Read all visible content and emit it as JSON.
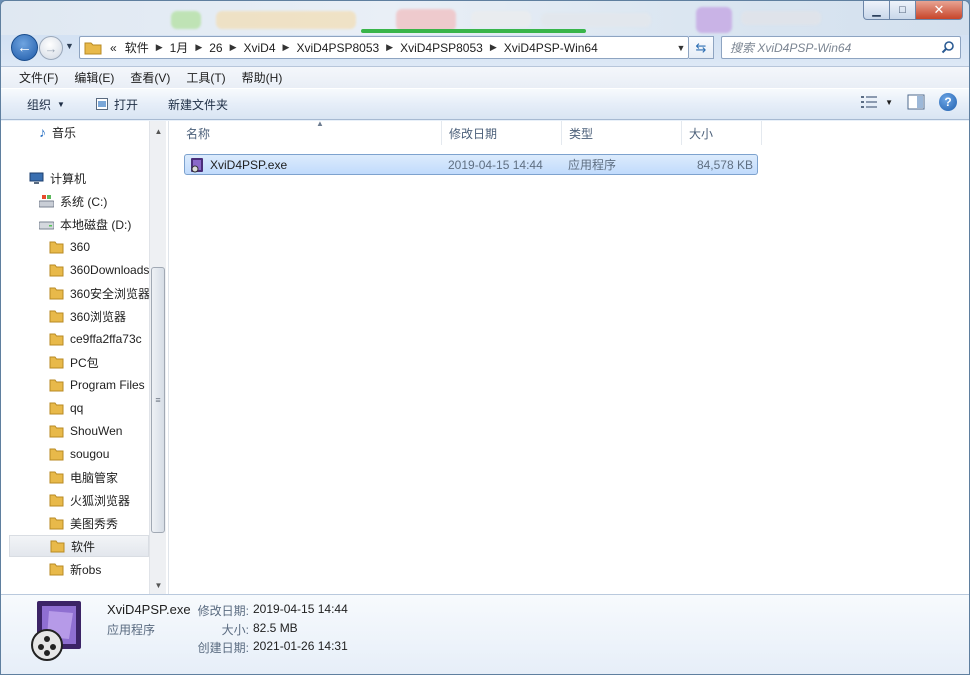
{
  "window": {
    "caption": {
      "minimize": "▁",
      "maximize": "□",
      "close": "✕"
    }
  },
  "nav": {
    "back_icon": "arrow-left-icon",
    "forward_icon": "arrow-right-icon",
    "breadcrumbs": [
      "«",
      "软件",
      "1月",
      "26",
      "XviD4",
      "XviD4PSP8053",
      "XviD4PSP8053",
      "XviD4PSP-Win64"
    ],
    "search_placeholder": "搜索 XviD4PSP-Win64"
  },
  "menu": [
    "文件(F)",
    "编辑(E)",
    "查看(V)",
    "工具(T)",
    "帮助(H)"
  ],
  "commands": {
    "organize": "组织",
    "open": "打开",
    "new_folder": "新建文件夹"
  },
  "sidebar": {
    "items": [
      {
        "label": "音乐",
        "icon": "music-icon"
      },
      {
        "label": "计算机",
        "icon": "computer-icon"
      },
      {
        "label": "系统 (C:)",
        "icon": "drive-c-icon"
      },
      {
        "label": "本地磁盘 (D:)",
        "icon": "drive-icon"
      },
      {
        "label": "360",
        "icon": "folder-icon"
      },
      {
        "label": "360Downloads",
        "icon": "folder-icon"
      },
      {
        "label": "360安全浏览器",
        "icon": "folder-icon"
      },
      {
        "label": "360浏览器",
        "icon": "folder-icon"
      },
      {
        "label": "ce9ffa2ffa73c",
        "icon": "folder-icon"
      },
      {
        "label": "PC包",
        "icon": "folder-icon"
      },
      {
        "label": "Program Files",
        "icon": "folder-icon"
      },
      {
        "label": "qq",
        "icon": "folder-icon"
      },
      {
        "label": "ShouWen",
        "icon": "folder-icon"
      },
      {
        "label": "sougou",
        "icon": "folder-icon"
      },
      {
        "label": "电脑管家",
        "icon": "folder-icon"
      },
      {
        "label": "火狐浏览器",
        "icon": "folder-icon"
      },
      {
        "label": "美图秀秀",
        "icon": "folder-icon"
      },
      {
        "label": "软件",
        "icon": "folder-icon"
      },
      {
        "label": "新obs",
        "icon": "folder-icon"
      }
    ],
    "selected": "软件"
  },
  "filelist": {
    "columns": [
      "名称",
      "修改日期",
      "类型",
      "大小"
    ],
    "rows": [
      {
        "name": "XviD4PSP.exe",
        "modified": "2019-04-15 14:44",
        "type": "应用程序",
        "size": "84,578 KB"
      }
    ]
  },
  "details": {
    "filename": "XviD4PSP.exe",
    "type": "应用程序",
    "modified_label": "修改日期:",
    "modified": "2019-04-15 14:44",
    "size_label": "大小:",
    "size": "82.5 MB",
    "created_label": "创建日期:",
    "created": "2021-01-26 14:31"
  },
  "colors": {
    "accent": "#1e5aa8",
    "selection": "#c1dbfc",
    "folder": "#e8b94a"
  }
}
